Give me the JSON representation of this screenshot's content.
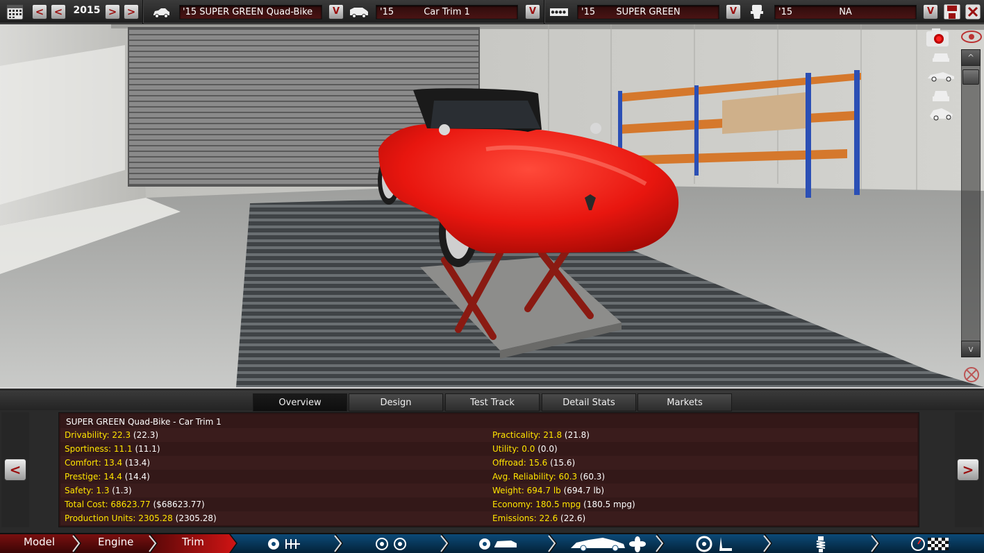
{
  "topbar": {
    "year": "2015",
    "model_year": "'15",
    "model_name": "'15 SUPER GREEN Quad-Bike",
    "trim_year": "'15",
    "trim_name": "Car Trim 1",
    "engine_year": "'15",
    "engine_name": "SUPER GREEN",
    "fuel_year": "'15",
    "fuel_name": "NA",
    "prev_label": "<",
    "next_label": ">",
    "dropdown_label": "V"
  },
  "viewport": {
    "scroll_up": "^",
    "scroll_down": "v",
    "car_color": "#e8160f"
  },
  "tabs": [
    {
      "label": "Overview"
    },
    {
      "label": "Design"
    },
    {
      "label": "Test Track"
    },
    {
      "label": "Detail Stats"
    },
    {
      "label": "Markets"
    }
  ],
  "stats": {
    "title": "SUPER GREEN Quad-Bike - Car Trim 1",
    "left": [
      {
        "label": "Drivability: 22.3",
        "base": "(22.3)"
      },
      {
        "label": "Sportiness: 11.1",
        "base": "(11.1)"
      },
      {
        "label": "Comfort: 13.4",
        "base": "(13.4)"
      },
      {
        "label": "Prestige: 14.4",
        "base": "(14.4)"
      },
      {
        "label": "Safety: 1.3",
        "base": "(1.3)"
      },
      {
        "label": "Total Cost: 68623.77",
        "base": "($68623.77)"
      },
      {
        "label": "Production Units: 2305.28",
        "base": "(2305.28)"
      }
    ],
    "right": [
      {
        "label": "Practicality: 21.8",
        "base": "(21.8)"
      },
      {
        "label": "Utility: 0.0",
        "base": "(0.0)"
      },
      {
        "label": "Offroad: 15.6",
        "base": "(15.6)"
      },
      {
        "label": "Avg. Reliability: 60.3",
        "base": "(60.3)"
      },
      {
        "label": "Weight: 694.7 lb",
        "base": "(694.7 lb)"
      },
      {
        "label": "Economy: 180.5 mpg",
        "base": "(180.5 mpg)"
      },
      {
        "label": "Emissions: 22.6",
        "base": "(22.6)"
      }
    ],
    "prev_label": "<",
    "next_label": ">"
  },
  "bottomnav": {
    "model": "Model",
    "engine": "Engine",
    "trim": "Trim"
  }
}
